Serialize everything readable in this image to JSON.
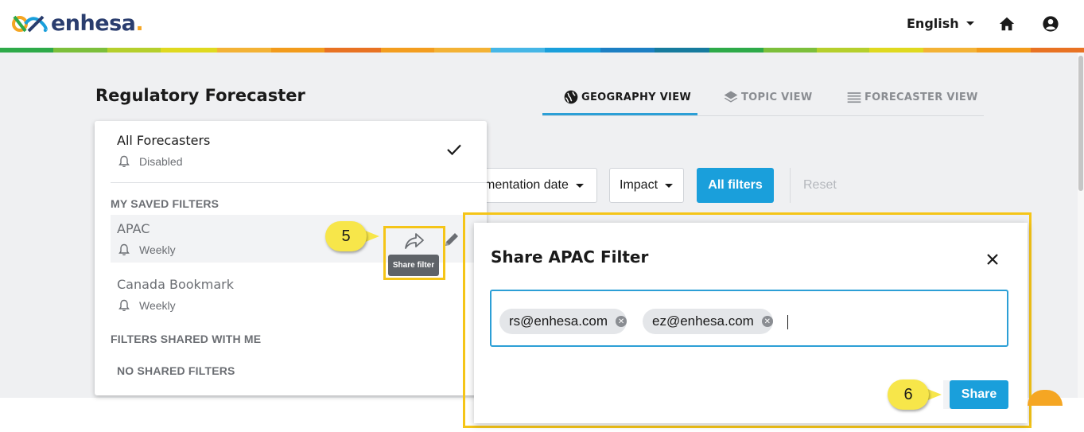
{
  "header": {
    "logo_text": "enhesa",
    "logo_dot": ".",
    "language": "English",
    "colors": [
      "#2eaa49",
      "#7cbf3b",
      "#b5cf2c",
      "#dfd91f",
      "#f3b235",
      "#f29b1c",
      "#e87223",
      "#f39d1f",
      "#f3b235",
      "#45b6e6",
      "#1a9fdb",
      "#1c7fc3",
      "#167b9e"
    ]
  },
  "page": {
    "title": "Regulatory Forecaster"
  },
  "views": {
    "geography": "GEOGRAPHY VIEW",
    "topic": "TOPIC VIEW",
    "forecaster": "FORECASTER VIEW",
    "active": "geography"
  },
  "filters": {
    "implementation": "mentation date",
    "impact": "Impact",
    "all_filters": "All filters",
    "reset": "Reset"
  },
  "dropdown": {
    "all_label": "All Forecasters",
    "all_status": "Disabled",
    "saved_heading": "MY SAVED FILTERS",
    "saved": [
      {
        "name": "APAC",
        "frequency": "Weekly"
      },
      {
        "name": "Canada Bookmark",
        "frequency": "Weekly"
      }
    ],
    "shared_heading": "FILTERS SHARED WITH ME",
    "no_shared": "NO SHARED FILTERS",
    "tooltip": "Share filter"
  },
  "modal": {
    "title": "Share APAC Filter",
    "emails": [
      "rs@enhesa.com",
      "ez@enhesa.com"
    ],
    "share_label": "Share"
  },
  "callouts": {
    "step5": "5",
    "step6": "6"
  }
}
